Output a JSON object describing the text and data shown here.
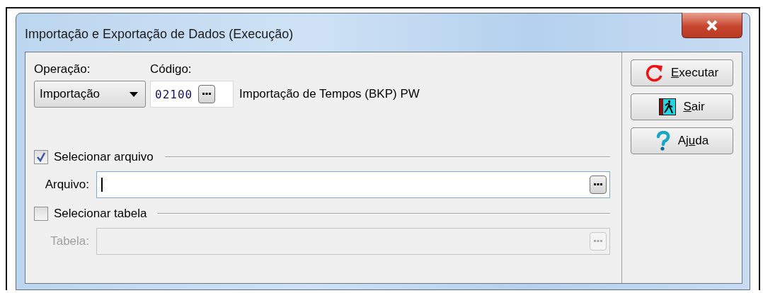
{
  "window": {
    "title": "Importação e Exportação de Dados (Execução)"
  },
  "operation": {
    "label": "Operação:",
    "value": "Importação"
  },
  "code": {
    "label": "Código:",
    "value": "02100",
    "description": "Importação de Tempos (BKP) PW"
  },
  "file_section": {
    "label": "Selecionar arquivo",
    "checked": true,
    "field_label": "Arquivo:",
    "disabled": false
  },
  "table_section": {
    "label": "Selecionar tabela",
    "checked": false,
    "field_label": "Tabela:",
    "disabled": true
  },
  "buttons": [
    {
      "kind": "execute",
      "accel": "E",
      "after": "xecutar"
    },
    {
      "kind": "exit",
      "accel": "S",
      "after": "air"
    },
    {
      "kind": "help",
      "before": "Aj",
      "accel": "u",
      "after": "da"
    }
  ]
}
